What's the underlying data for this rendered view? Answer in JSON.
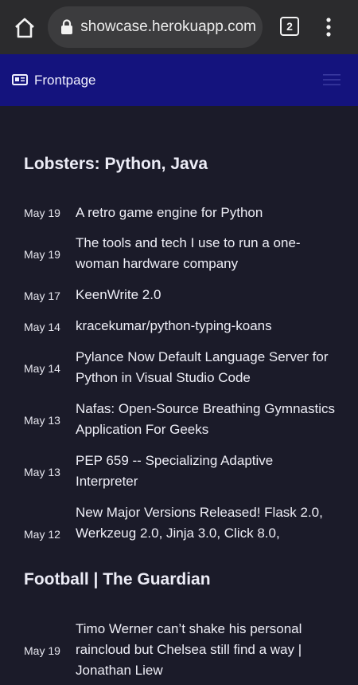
{
  "browser": {
    "url": "showcase.herokuapp.com",
    "tab_count": "2"
  },
  "navbar": {
    "brand": "Frontpage"
  },
  "sections": [
    {
      "title": "Lobsters: Python, Java",
      "items": [
        {
          "date": "May 19",
          "title": "A retro game engine for Python"
        },
        {
          "date": "May 19",
          "title": "The tools and tech I use to run a one-woman hardware company"
        },
        {
          "date": "May 17",
          "title": "KeenWrite 2.0"
        },
        {
          "date": "May 14",
          "title": "kracekumar/python-typing-koans"
        },
        {
          "date": "May 14",
          "title": "Pylance Now Default Language Server for Python in Visual Studio Code"
        },
        {
          "date": "May 13",
          "title": "Nafas: Open-Source Breathing Gymnastics Application For Geeks"
        },
        {
          "date": "May 13",
          "title": "PEP 659 -- Specializing Adaptive Interpreter"
        },
        {
          "date": "May 12",
          "title": "New Major Versions Released! Flask 2.0, Werkzeug 2.0, Jinja 3.0, Click 8.0,"
        }
      ]
    },
    {
      "title": "Football | The Guardian",
      "items": [
        {
          "date": "May 19",
          "title": "Timo Werner can’t shake his personal raincloud but Chelsea still find a way | Jonathan Liew"
        }
      ]
    }
  ]
}
